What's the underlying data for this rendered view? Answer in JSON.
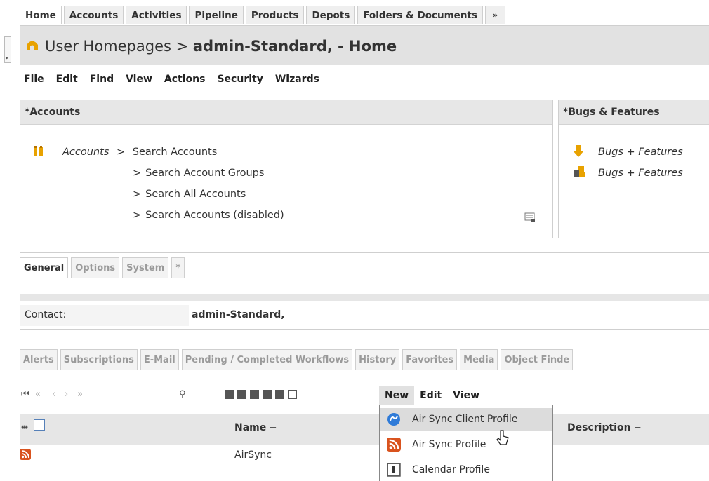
{
  "top_tabs": [
    "Home",
    "Accounts",
    "Activities",
    "Pipeline",
    "Products",
    "Depots",
    "Folders & Documents",
    "»"
  ],
  "breadcrumb": {
    "prefix": "User Homepages >",
    "current": "admin-Standard, - Home"
  },
  "menu": [
    "File",
    "Edit",
    "Find",
    "View",
    "Actions",
    "Security",
    "Wizards"
  ],
  "accounts_panel": {
    "title": "*Accounts",
    "section": "Accounts",
    "links": [
      "Search Accounts",
      "Search Account Groups",
      "Search All Accounts",
      "Search Accounts (disabled)"
    ]
  },
  "bugs_panel": {
    "title": "*Bugs & Features",
    "links": [
      "Bugs + Features",
      "Bugs + Features"
    ]
  },
  "general_tabs": [
    "General",
    "Options",
    "System",
    "*"
  ],
  "contact": {
    "label": "Contact:",
    "value": "admin-Standard,"
  },
  "bottom_tabs": [
    "Alerts",
    "Subscriptions",
    "E-Mail",
    "Pending / Completed Workflows",
    "History",
    "Favorites",
    "Media",
    "Object Finde"
  ],
  "grid": {
    "columns": {
      "name": "Name",
      "description": "Description"
    },
    "rows": [
      {
        "name": "AirSync"
      }
    ]
  },
  "context_menu": {
    "menus": [
      "New",
      "Edit",
      "View"
    ],
    "open_menu": "New",
    "items": [
      "Air Sync Client Profile",
      "Air Sync Profile",
      "Calendar Profile"
    ]
  },
  "colors": {
    "accent": "#e8a200",
    "rss": "#d9531e",
    "airsync_blue": "#2f7bd8"
  }
}
